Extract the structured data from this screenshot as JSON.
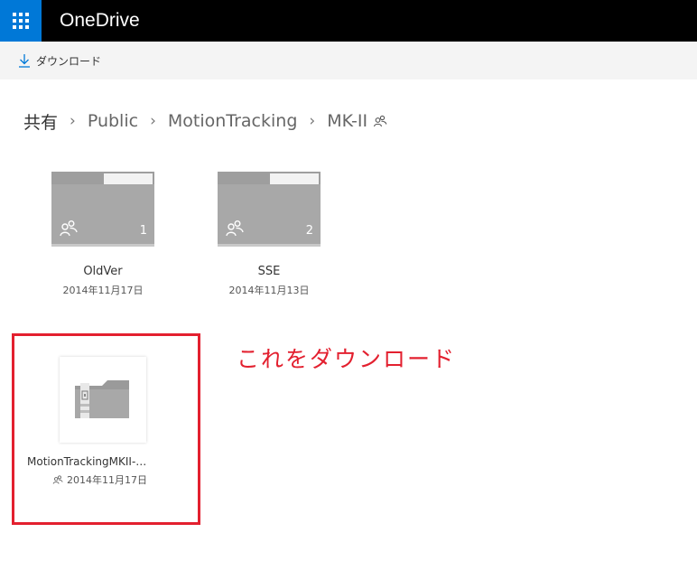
{
  "app": {
    "title": "OneDrive"
  },
  "commandbar": {
    "download_label": "ダウンロード"
  },
  "breadcrumb": {
    "items": [
      "共有",
      "Public",
      "MotionTracking",
      "MK-II"
    ],
    "separator": "›"
  },
  "folders": [
    {
      "name": "OldVer",
      "date": "2014年11月17日",
      "count": "1"
    },
    {
      "name": "SSE",
      "date": "2014年11月13日",
      "count": "2"
    }
  ],
  "file": {
    "name": "MotionTrackingMKII-…",
    "date": "2014年11月17日"
  },
  "annotation": {
    "text": "これをダウンロード"
  },
  "colors": {
    "accent": "#0078d7",
    "topbar": "#000000",
    "highlight": "#e3202f",
    "folder": "#a8a8a8"
  },
  "icons": [
    "waffle-icon",
    "download-icon",
    "shared-people-icon",
    "folder-icon",
    "zip-file-icon"
  ]
}
